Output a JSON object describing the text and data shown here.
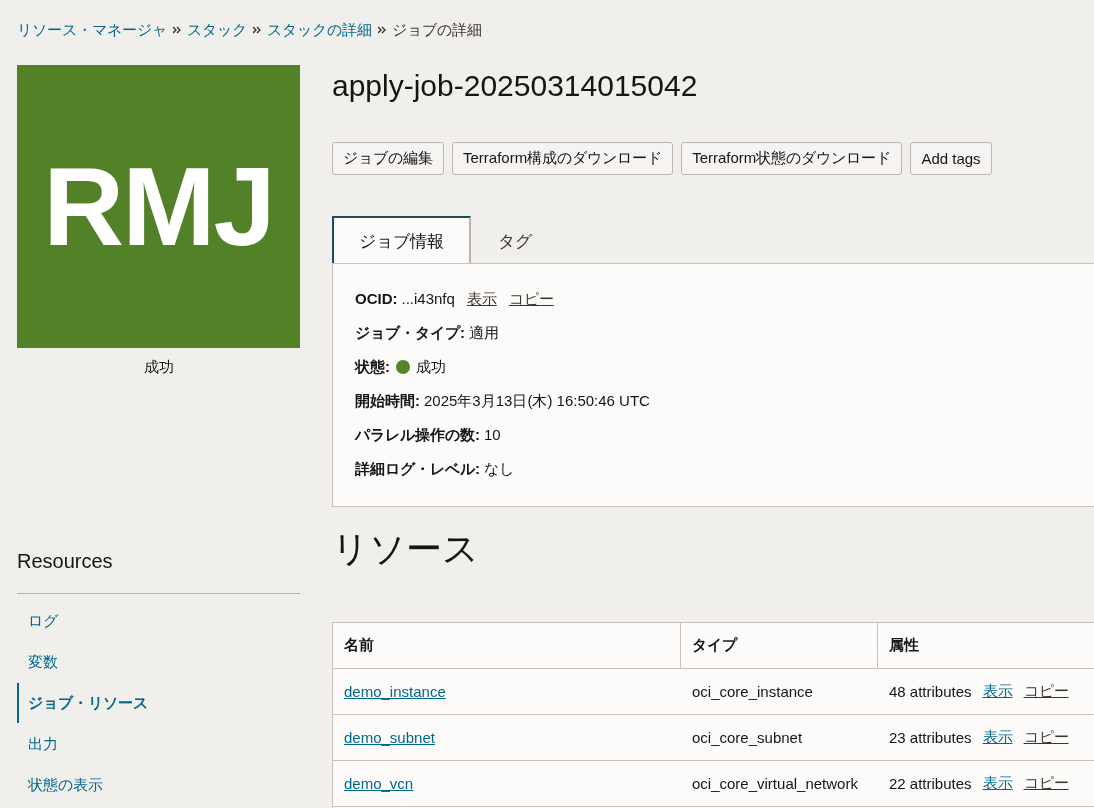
{
  "breadcrumb": [
    {
      "label": "リソース・マネージャ",
      "link": true
    },
    {
      "label": "スタック",
      "link": true
    },
    {
      "label": "スタックの詳細",
      "link": true
    },
    {
      "label": "ジョブの詳細",
      "link": false
    }
  ],
  "tile": {
    "text": "RMJ",
    "status": "成功"
  },
  "title": "apply-job-20250314015042",
  "buttons": [
    "ジョブの編集",
    "Terraform構成のダウンロード",
    "Terraform状態のダウンロード",
    "Add tags"
  ],
  "tabs": [
    {
      "label": "ジョブ情報",
      "selected": true
    },
    {
      "label": "タグ",
      "selected": false
    }
  ],
  "details": [
    {
      "kind": "ocid",
      "label": "OCID:",
      "value": "...i43nfq",
      "links": [
        "表示",
        "コピー"
      ]
    },
    {
      "kind": "text",
      "label": "ジョブ・タイプ:",
      "value": "適用"
    },
    {
      "kind": "status",
      "label": "状態:",
      "value": "成功",
      "color": "#548528"
    },
    {
      "kind": "text",
      "label": "開始時間:",
      "value": "2025年3月13日(木) 16:50:46 UTC"
    },
    {
      "kind": "text",
      "label": "パラレル操作の数:",
      "value": "10"
    },
    {
      "kind": "text",
      "label": "詳細ログ・レベル:",
      "value": "なし"
    }
  ],
  "sidebar": {
    "title": "Resources",
    "items": [
      {
        "label": "ログ",
        "selected": false
      },
      {
        "label": "変数",
        "selected": false
      },
      {
        "label": "ジョブ・リソース",
        "selected": true
      },
      {
        "label": "出力",
        "selected": false
      },
      {
        "label": "状態の表示",
        "selected": false
      }
    ]
  },
  "section_title": "リソース",
  "table": {
    "columns": [
      "名前",
      "タイプ",
      "属性"
    ],
    "rows": [
      {
        "name": "demo_instance",
        "type": "oci_core_instance",
        "attributes": "48 attributes",
        "links": [
          "表示",
          "コピー"
        ]
      },
      {
        "name": "demo_subnet",
        "type": "oci_core_subnet",
        "attributes": "23 attributes",
        "links": [
          "表示",
          "コピー"
        ]
      },
      {
        "name": "demo_vcn",
        "type": "oci_core_virtual_network",
        "attributes": "22 attributes",
        "links": [
          "表示",
          "コピー"
        ]
      }
    ]
  }
}
